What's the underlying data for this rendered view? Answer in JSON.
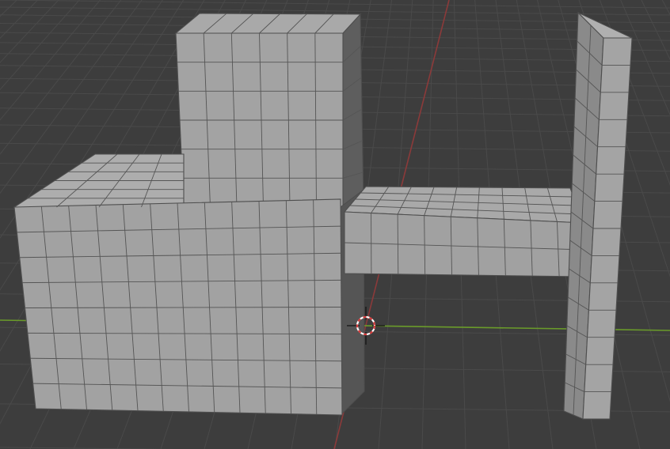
{
  "viewport": {
    "background": "#3d3d3d",
    "grid_color": "#4a4a4a",
    "x_axis_color": "#8b3a3a",
    "y_axis_color": "#6a9b2a",
    "mesh_face_front": "#a3a3a3",
    "mesh_face_top": "#aaaaaa",
    "mesh_face_side": "#7f7f7f",
    "mesh_face_dark": "#5b5b5b",
    "wire_color": "#4e4e4e",
    "cursor_color": "#d33a3a",
    "cursor_icon": "3d-cursor-icon"
  }
}
